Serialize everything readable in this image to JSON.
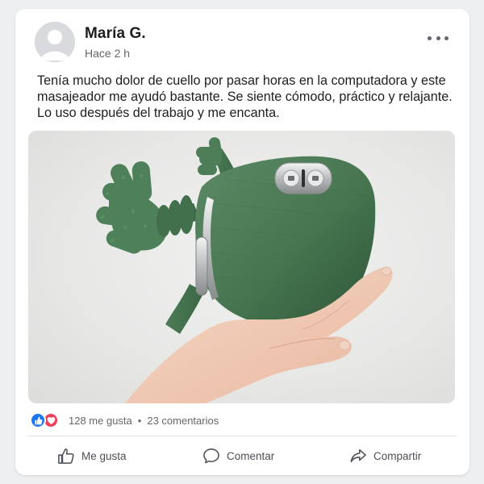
{
  "post": {
    "author": "María G.",
    "time": "Hace 2 h",
    "text": "Tenía mucho dolor de cuello por pasar horas en la computadora y este masajeador me ayudó bastante. Se siente cómodo, práctico y relajante. Lo uso después del trabajo y me encanta.",
    "photo_alt": "Masajeador verde sostenido en la mano"
  },
  "reactions": {
    "likes": "128 me gusta",
    "separator": "•",
    "comments": "23 comentarios",
    "types": [
      "like",
      "love"
    ]
  },
  "actions": {
    "like": "Me gusta",
    "comment": "Comentar",
    "share": "Compartir"
  },
  "colors": {
    "like_blue": "#1877f2",
    "love_red": "#f33e58",
    "device_green": "#4a7a56",
    "muted_text": "#65676b"
  },
  "icons": [
    "avatar-placeholder-icon",
    "more-options-icon",
    "like-reaction-icon",
    "love-reaction-icon",
    "thumbs-up-icon",
    "comment-bubble-icon",
    "share-arrow-icon"
  ]
}
